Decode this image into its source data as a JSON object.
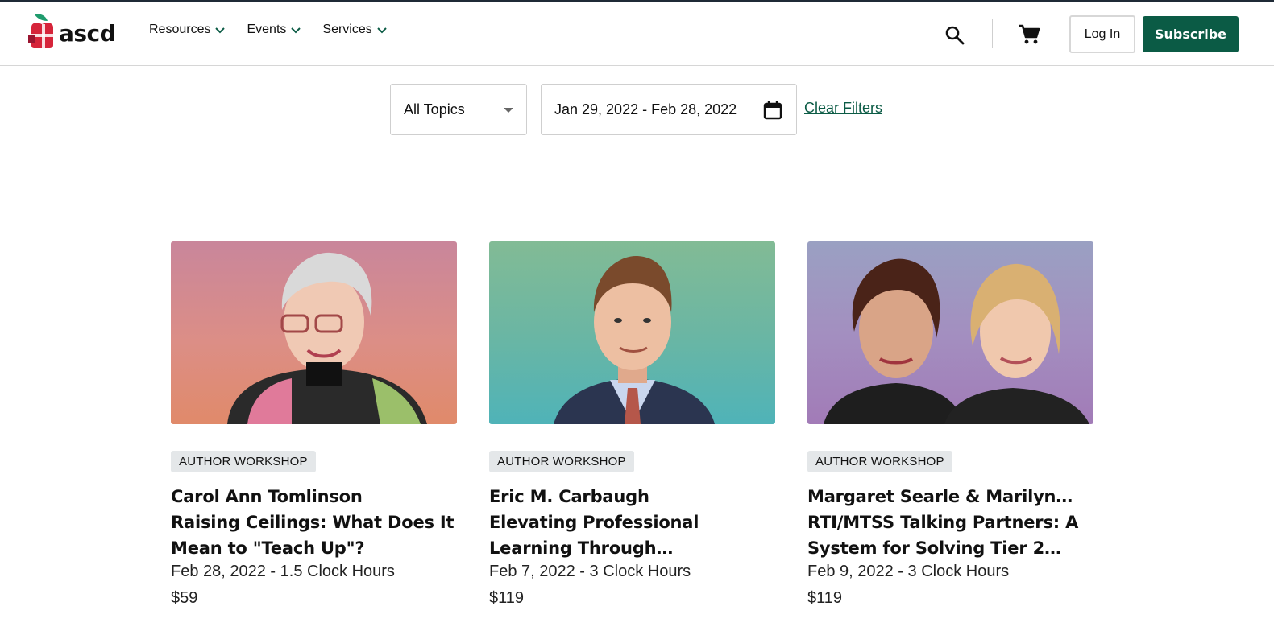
{
  "brand": {
    "name": "ascd",
    "colors": {
      "green": "#0b5b45",
      "red": "#d6243a",
      "leaf": "#1f9b6d"
    }
  },
  "nav": {
    "items": [
      {
        "label": "Resources"
      },
      {
        "label": "Events"
      },
      {
        "label": "Services"
      }
    ]
  },
  "header_actions": {
    "search_icon": "search-icon",
    "cart_icon": "cart-icon",
    "login_label": "Log In",
    "subscribe_label": "Subscribe"
  },
  "filters": {
    "topic_selected": "All Topics",
    "date_range": "Jan 29, 2022 - Feb 28, 2022",
    "clear_label": "Clear Filters"
  },
  "cards": [
    {
      "badge": "AUTHOR WORKSHOP",
      "title_lines": [
        "Carol Ann Tomlinson",
        "Raising Ceilings: What Does It",
        "Mean to \"Teach Up\"?"
      ],
      "meta": "Feb 28, 2022 - 1.5 Clock Hours",
      "price": "$59",
      "bg": [
        "#c9869b",
        "#e08a6a"
      ]
    },
    {
      "badge": "AUTHOR WORKSHOP",
      "title_lines": [
        "Eric M. Carbaugh",
        "Elevating Professional",
        "Learning Through…"
      ],
      "meta": "Feb 7, 2022 - 3 Clock Hours",
      "price": "$119",
      "bg": [
        "#7fba94",
        "#4fb3b8"
      ]
    },
    {
      "badge": "AUTHOR WORKSHOP",
      "title_lines": [
        "Margaret Searle & Marilyn…",
        "RTI/MTSS Talking Partners: A",
        "System for Solving Tier 2…"
      ],
      "meta": "Feb 9, 2022 - 3 Clock Hours",
      "price": "$119",
      "bg": [
        "#9a9fc2",
        "#a27bb7"
      ]
    }
  ]
}
